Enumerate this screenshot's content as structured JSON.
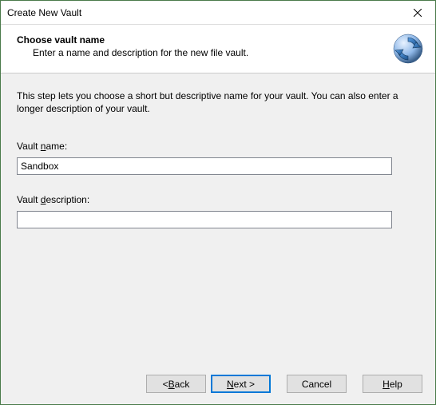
{
  "window": {
    "title": "Create New Vault"
  },
  "header": {
    "title": "Choose vault name",
    "subtitle": "Enter a name and description for the new file vault."
  },
  "content": {
    "intro": "This step lets you choose a short but descriptive name for your vault. You can also enter a longer description of your vault.",
    "vault_name_label_pre": "Vault ",
    "vault_name_label_ul": "n",
    "vault_name_label_post": "ame:",
    "vault_name_value": "Sandbox",
    "vault_desc_label_pre": "Vault ",
    "vault_desc_label_ul": "d",
    "vault_desc_label_post": "escription:",
    "vault_desc_value": ""
  },
  "buttons": {
    "back_pre": "< ",
    "back_ul": "B",
    "back_post": "ack",
    "next_ul": "N",
    "next_post": "ext >",
    "cancel": "Cancel",
    "help_ul": "H",
    "help_post": "elp"
  }
}
